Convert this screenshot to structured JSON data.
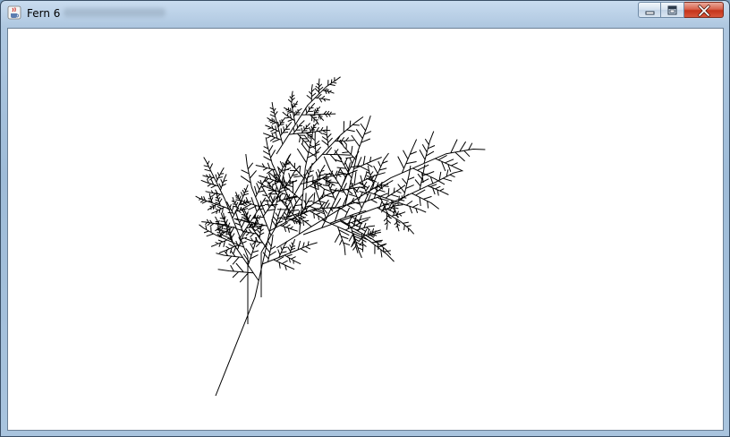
{
  "window": {
    "title": "Fern 6",
    "icon": "java-cup-icon",
    "controls": [
      "minimize-icon",
      "maximize-icon",
      "close-icon"
    ]
  },
  "canvas": {
    "background": "#ffffff",
    "stroke": "#000000"
  }
}
